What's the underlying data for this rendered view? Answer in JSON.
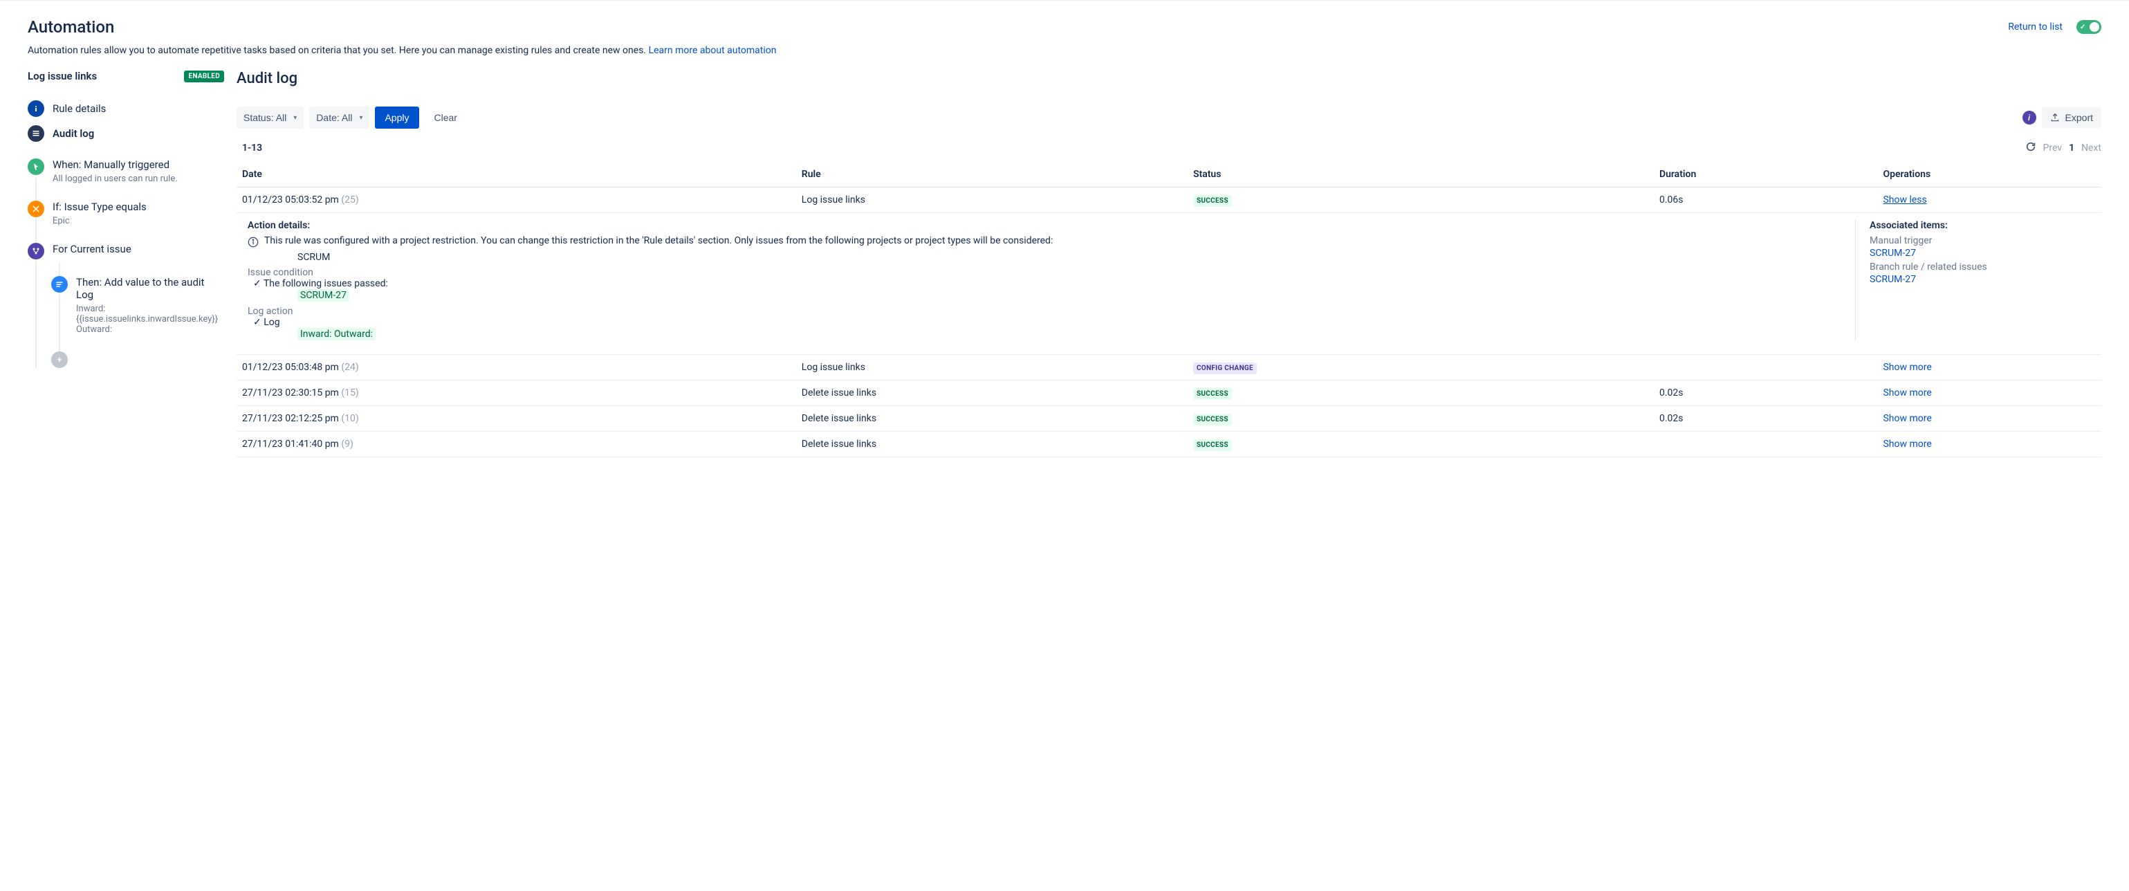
{
  "page": {
    "title": "Automation",
    "description": "Automation rules allow you to automate repetitive tasks based on criteria that you set. Here you can manage existing rules and create new ones. ",
    "learn_more": "Learn more about automation",
    "return_to_list": "Return to list"
  },
  "rule": {
    "name": "Log issue links",
    "status_badge": "ENABLED",
    "nav": {
      "rule_details": "Rule details",
      "audit_log": "Audit log"
    },
    "timeline": {
      "trigger_title": "When: Manually triggered",
      "trigger_sub": "All logged in users can run rule.",
      "cond_title": "If: Issue Type equals",
      "cond_sub": "Epic",
      "branch_title": "For Current issue",
      "action_title": "Then: Add value to the audit Log",
      "action_sub": "Inward: {{issue.issuelinks.inwardIssue.key}} Outward:"
    }
  },
  "main": {
    "title": "Audit log",
    "filters": {
      "status": "Status: All",
      "date": "Date: All",
      "apply": "Apply",
      "clear": "Clear",
      "export": "Export"
    },
    "pagination": {
      "range": "1-13",
      "prev": "Prev",
      "current": "1",
      "next": "Next"
    },
    "columns": {
      "date": "Date",
      "rule": "Rule",
      "status": "Status",
      "duration": "Duration",
      "operations": "Operations"
    },
    "rows": [
      {
        "date": "01/12/23 05:03:52 pm",
        "count": "(25)",
        "rule": "Log issue links",
        "status": "SUCCESS",
        "status_type": "success",
        "duration": "0.06s",
        "op": "Show less",
        "expanded": true
      },
      {
        "date": "01/12/23 05:03:48 pm",
        "count": "(24)",
        "rule": "Log issue links",
        "status": "CONFIG CHANGE",
        "status_type": "config",
        "duration": "",
        "op": "Show more"
      },
      {
        "date": "27/11/23 02:30:15 pm",
        "count": "(15)",
        "rule": "Delete issue links",
        "status": "SUCCESS",
        "status_type": "success",
        "duration": "0.02s",
        "op": "Show more"
      },
      {
        "date": "27/11/23 02:12:25 pm",
        "count": "(10)",
        "rule": "Delete issue links",
        "status": "SUCCESS",
        "status_type": "success",
        "duration": "0.02s",
        "op": "Show more"
      },
      {
        "date": "27/11/23 01:41:40 pm",
        "count": "(9)",
        "rule": "Delete issue links",
        "status": "SUCCESS",
        "status_type": "success",
        "duration": "",
        "op": "Show more"
      }
    ],
    "expanded": {
      "action_details": "Action details:",
      "notice": "This rule was configured with a project restriction. You can change this restriction in the 'Rule details' section. Only issues from the following projects or project types will be considered:",
      "project": "SCRUM",
      "issue_condition": "Issue condition",
      "passed_text": "The following issues passed:",
      "passed_issue": "SCRUM-27",
      "log_action": "Log action",
      "log_text": "Log",
      "log_value": "Inward: Outward:",
      "assoc_title": "Associated items:",
      "assoc_1_label": "Manual trigger",
      "assoc_1_link": "SCRUM-27",
      "assoc_2_label": "Branch rule / related issues",
      "assoc_2_link": "SCRUM-27"
    }
  }
}
